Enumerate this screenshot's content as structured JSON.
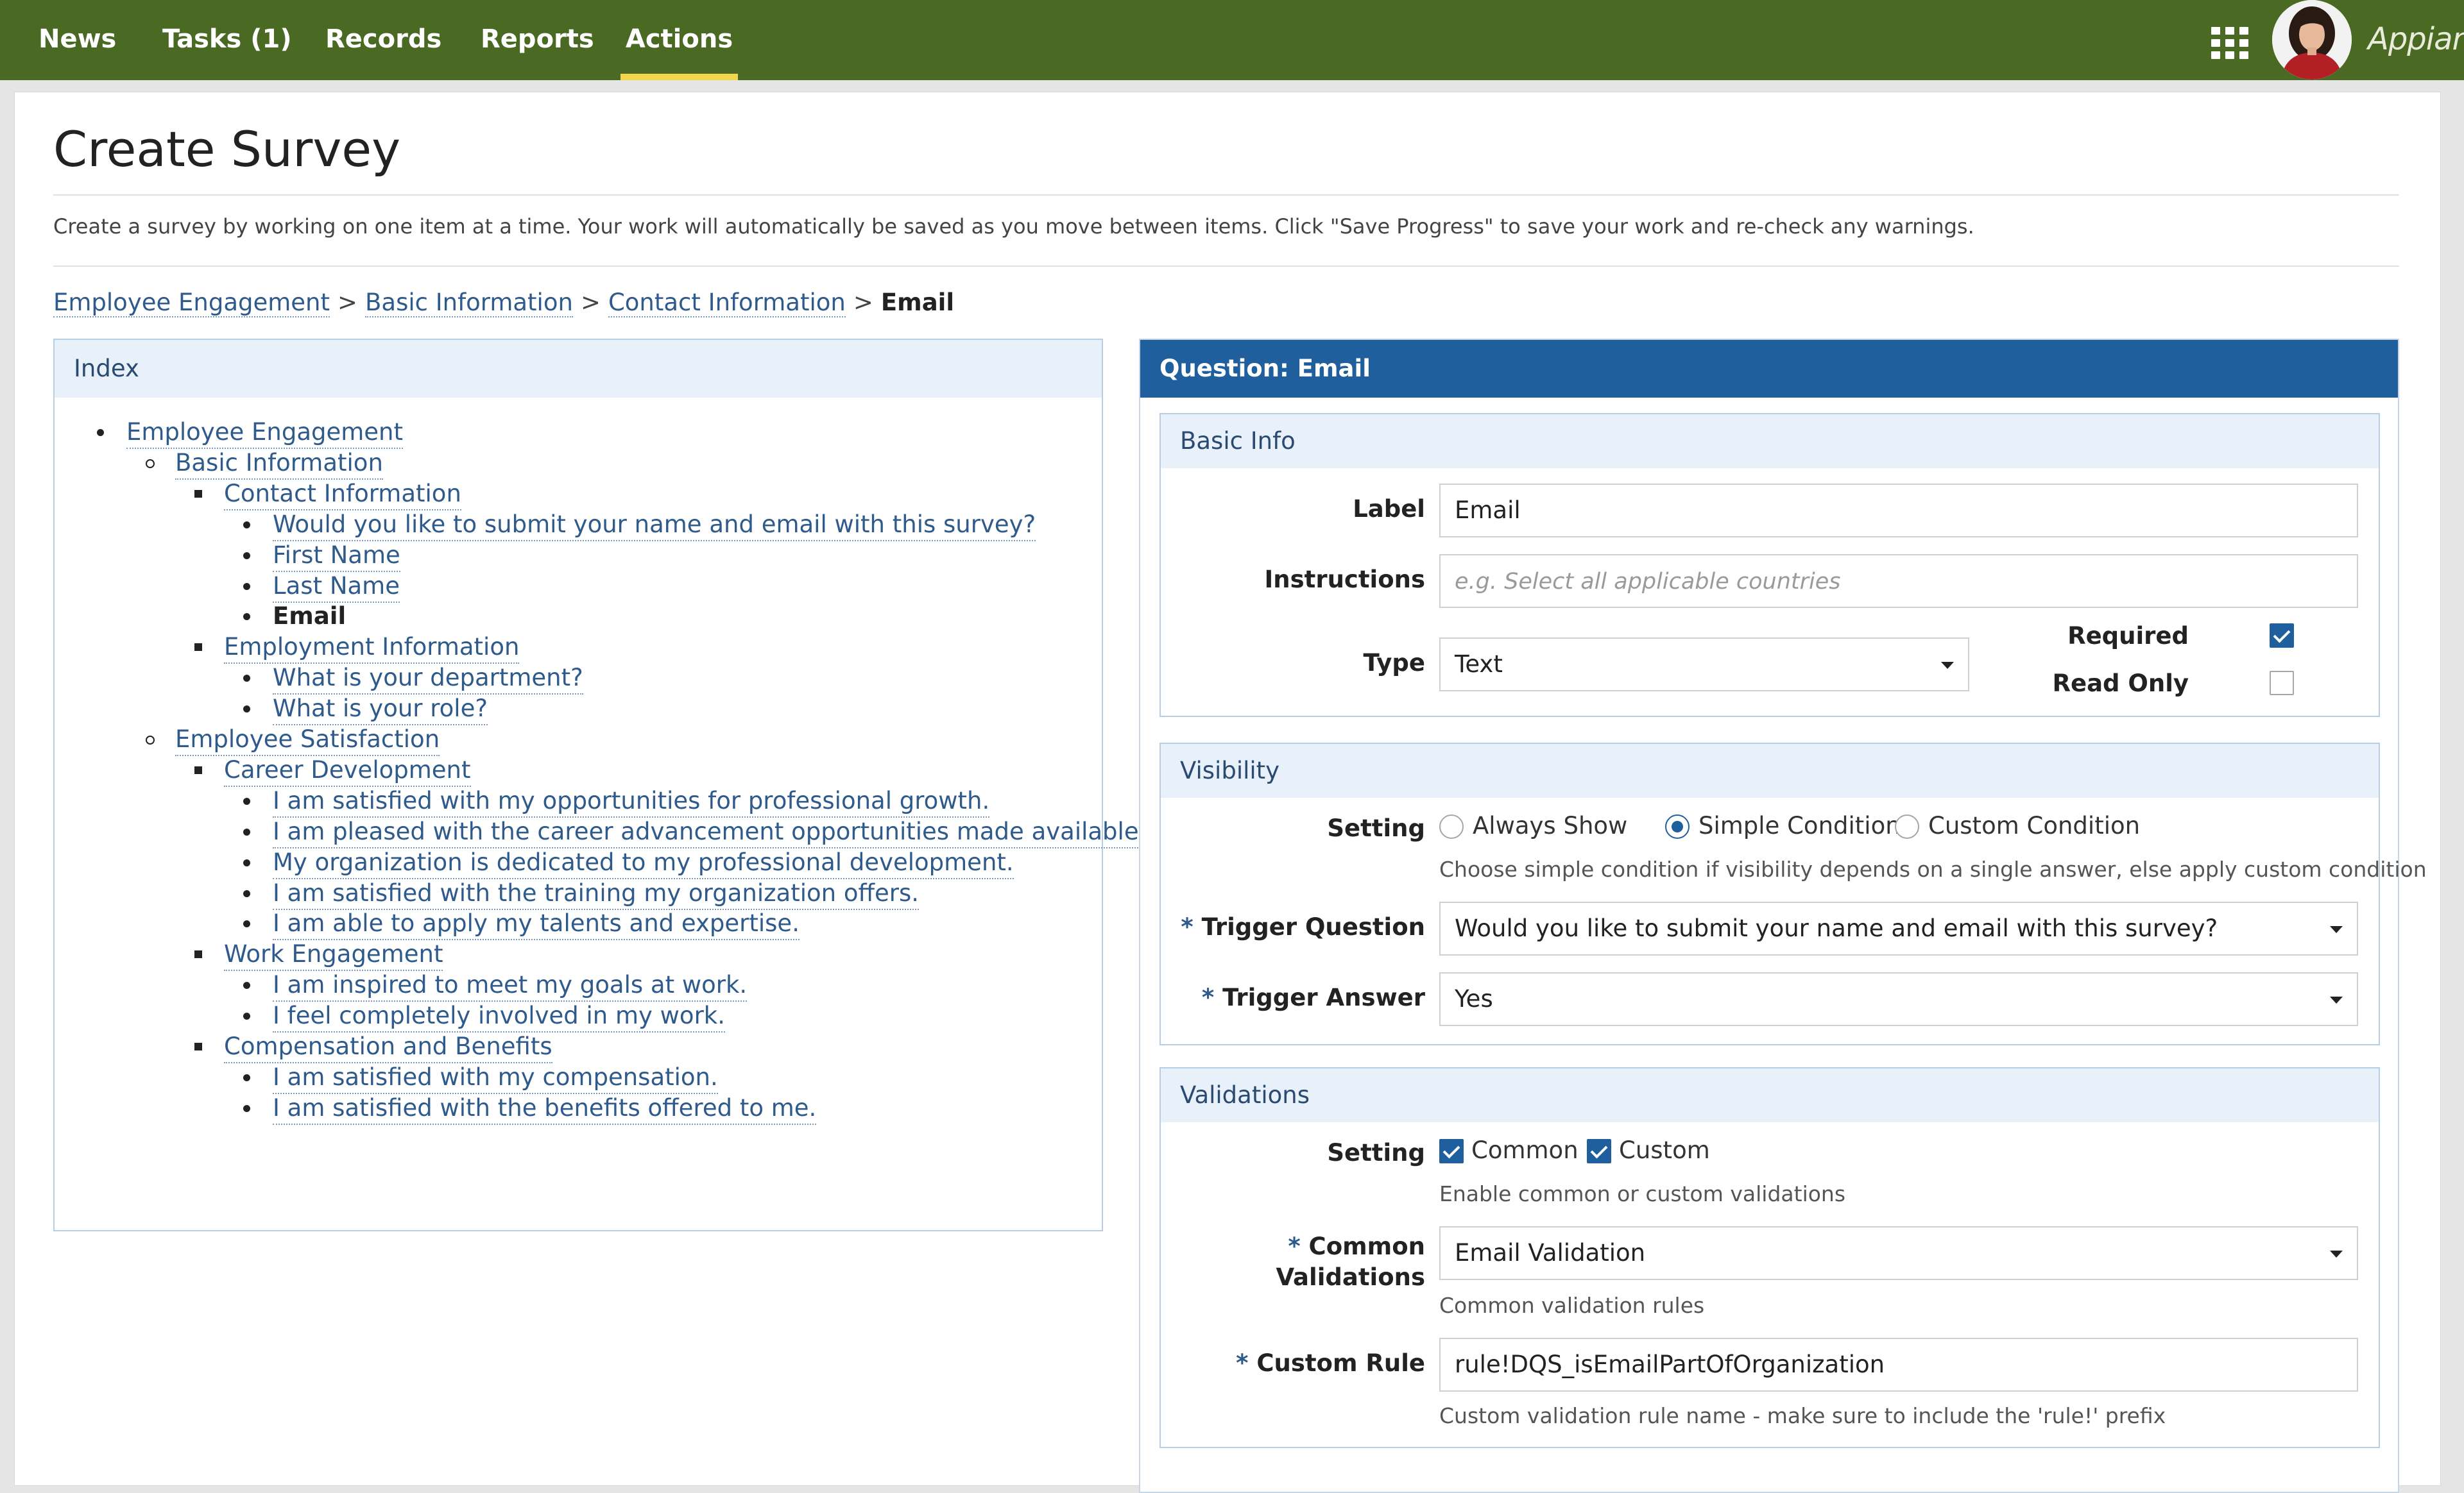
{
  "nav": {
    "items": [
      {
        "label": "News"
      },
      {
        "label": "Tasks (1)"
      },
      {
        "label": "Records"
      },
      {
        "label": "Reports"
      },
      {
        "label": "Actions",
        "active": true
      }
    ],
    "brand": "Appian",
    "apps_icon": "grid-icon",
    "accent_color": "#f4d64e",
    "bar_color": "#4a6a23"
  },
  "page": {
    "title": "Create Survey",
    "description": "Create a survey by working on one item at a time. Your work will automatically be saved as you move between items. Click \"Save Progress\" to save your work and re-check any warnings."
  },
  "breadcrumb": {
    "items": [
      "Employee Engagement",
      "Basic Information",
      "Contact Information"
    ],
    "separator": ">",
    "current": "Email"
  },
  "index": {
    "title": "Index",
    "items": [
      {
        "label": "Employee Engagement",
        "level": 1
      },
      {
        "label": "Basic Information",
        "level": 2
      },
      {
        "label": "Contact Information",
        "level": 3
      },
      {
        "label": "Would you like to submit your name and email with this survey?",
        "level": 4
      },
      {
        "label": "First Name",
        "level": 4
      },
      {
        "label": "Last Name",
        "level": 4
      },
      {
        "label": "Email",
        "level": 4,
        "current": true
      },
      {
        "label": "Employment Information",
        "level": 3
      },
      {
        "label": "What is your department?",
        "level": 4
      },
      {
        "label": "What is your role?",
        "level": 4
      },
      {
        "label": "Employee Satisfaction",
        "level": 2
      },
      {
        "label": "Career Development",
        "level": 3
      },
      {
        "label": "I am satisfied with my opportunities for professional growth.",
        "level": 4
      },
      {
        "label": "I am pleased with the career advancement opportunities made available.",
        "level": 4
      },
      {
        "label": "My organization is dedicated to my professional development.",
        "level": 4
      },
      {
        "label": "I am satisfied with the training my organization offers.",
        "level": 4
      },
      {
        "label": "I am able to apply my talents and expertise.",
        "level": 4
      },
      {
        "label": "Work Engagement",
        "level": 3
      },
      {
        "label": "I am inspired to meet my goals at work.",
        "level": 4
      },
      {
        "label": "I feel completely involved in my work.",
        "level": 4
      },
      {
        "label": "Compensation and Benefits",
        "level": 3
      },
      {
        "label": "I am satisfied with my compensation.",
        "level": 4
      },
      {
        "label": "I am satisfied with the benefits offered to me.",
        "level": 4
      }
    ]
  },
  "question": {
    "header": "Question: Email",
    "basic": {
      "title": "Basic Info",
      "label_label": "Label",
      "label_value": "Email",
      "instructions_label": "Instructions",
      "instructions_placeholder": "e.g. Select all applicable countries",
      "type_label": "Type",
      "type_value": "Text",
      "required_label": "Required",
      "required_checked": true,
      "readonly_label": "Read Only",
      "readonly_checked": false
    },
    "visibility": {
      "title": "Visibility",
      "setting_label": "Setting",
      "options": [
        "Always Show",
        "Simple Condition",
        "Custom Condition"
      ],
      "selected": "Simple Condition",
      "setting_hint": "Choose simple condition if visibility depends on a single answer, else apply custom condition",
      "required_marker": "*",
      "trigger_question_label": "Trigger Question",
      "trigger_question_value": "Would you like to submit your name and email with this survey?",
      "trigger_answer_label": "Trigger Answer",
      "trigger_answer_value": "Yes"
    },
    "validations": {
      "title": "Validations",
      "setting_label": "Setting",
      "common_label": "Common",
      "common_checked": true,
      "custom_label": "Custom",
      "custom_checked": true,
      "setting_hint": "Enable common or custom validations",
      "common_validations_label_1": "Common",
      "common_validations_label_2": "Validations",
      "common_validations_value": "Email Validation",
      "common_validations_hint": "Common validation rules",
      "custom_rule_label": "Custom Rule",
      "custom_rule_value": "rule!DQS_isEmailPartOfOrganization",
      "custom_rule_hint": "Custom validation rule name - make sure to include the 'rule!' prefix"
    }
  }
}
